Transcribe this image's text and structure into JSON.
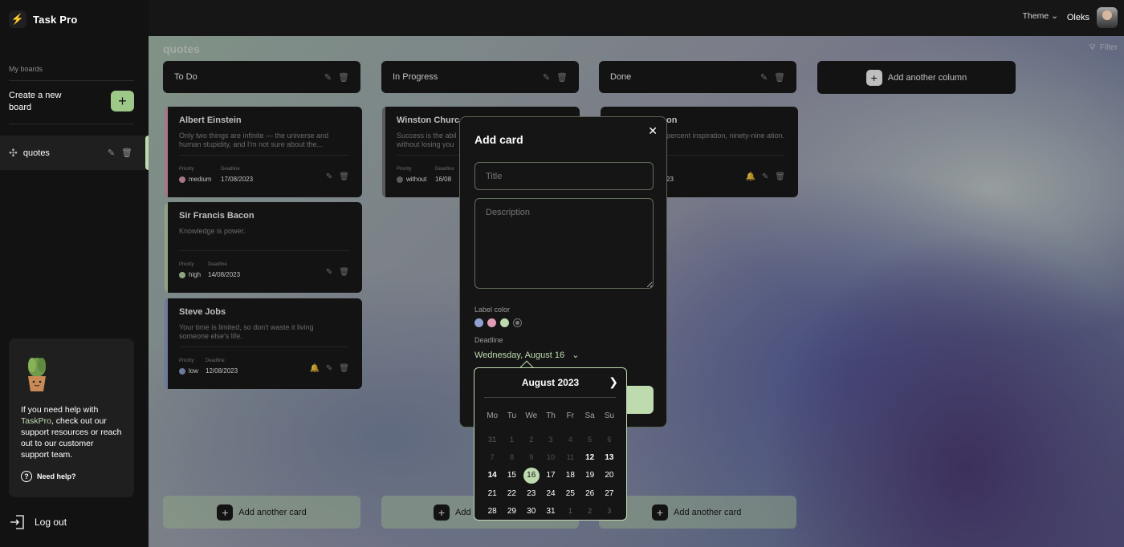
{
  "app": {
    "name": "Task Pro"
  },
  "sidebar": {
    "my_boards_label": "My boards",
    "create_board_label": "Create a new board",
    "create_button_icon": "plus-icon",
    "boards": [
      {
        "name": "quotes",
        "icon": "puzzle-icon"
      }
    ],
    "help": {
      "text_before": "If you need help with ",
      "brand": "TaskPro",
      "text_after": ", check out our support resources or reach out to our customer support team.",
      "link": "Need help?"
    },
    "logout": "Log out"
  },
  "header": {
    "theme": "Theme",
    "user_name": "Oleks"
  },
  "board": {
    "title": "quotes",
    "filter": "Filter",
    "add_column": "Add another column",
    "add_card": "Add another card",
    "columns": [
      {
        "title": "To Do"
      },
      {
        "title": "In Progress"
      },
      {
        "title": "Done"
      }
    ],
    "cards": [
      {
        "title": "Albert Einstein",
        "description": "Only two things are infinite — the universe and human stupidity, and I'm not sure about the...",
        "priority_label": "Priority",
        "priority": "medium",
        "priority_color": "#e09cb5",
        "deadline_label": "Deadline",
        "deadline": "17/08/2023"
      },
      {
        "title": "Sir Francis Bacon",
        "description": "Knowledge is power.",
        "priority_label": "Priority",
        "priority": "high",
        "priority_color": "#bedbb0",
        "deadline_label": "Deadline",
        "deadline": "14/08/2023"
      },
      {
        "title": "Steve Jobs",
        "description": "Your time is limited, so don't waste it living someone else's life.",
        "priority_label": "Priority",
        "priority": "low",
        "priority_color": "#8fa1d0",
        "deadline_label": "Deadline",
        "deadline": "12/08/2023"
      },
      {
        "title": "Winston Churc",
        "description": "Success is the abil without losing you",
        "priority_label": "Priority",
        "priority": "without",
        "priority_color": "#777777",
        "deadline_label": "Deadline",
        "deadline": "16/08"
      },
      {
        "title": "on",
        "description": "percent inspiration, ninety-nine ation.",
        "deadline": "23"
      }
    ],
    "add_card_partial": "Add"
  },
  "modal": {
    "title": "Add card",
    "title_placeholder": "Title",
    "description_placeholder": "Description",
    "label_color": "Label color",
    "colors": [
      "#8fa1d0",
      "#e09cb5",
      "#bedbb0",
      "#777777"
    ],
    "deadline_label": "Deadline",
    "deadline_value": "Wednesday, August 16"
  },
  "calendar": {
    "month": "August 2023",
    "weekdays": [
      "Mo",
      "Tu",
      "We",
      "Th",
      "Fr",
      "Sa",
      "Su"
    ],
    "weeks": [
      [
        "31",
        "1",
        "2",
        "3",
        "4",
        "5",
        "6"
      ],
      [
        "7",
        "8",
        "9",
        "10",
        "11",
        "12",
        "13"
      ],
      [
        "14",
        "15",
        "16",
        "17",
        "18",
        "19",
        "20"
      ],
      [
        "21",
        "22",
        "23",
        "24",
        "25",
        "26",
        "27"
      ],
      [
        "28",
        "29",
        "30",
        "31",
        "1",
        "2",
        "3"
      ]
    ],
    "selected": "16"
  }
}
